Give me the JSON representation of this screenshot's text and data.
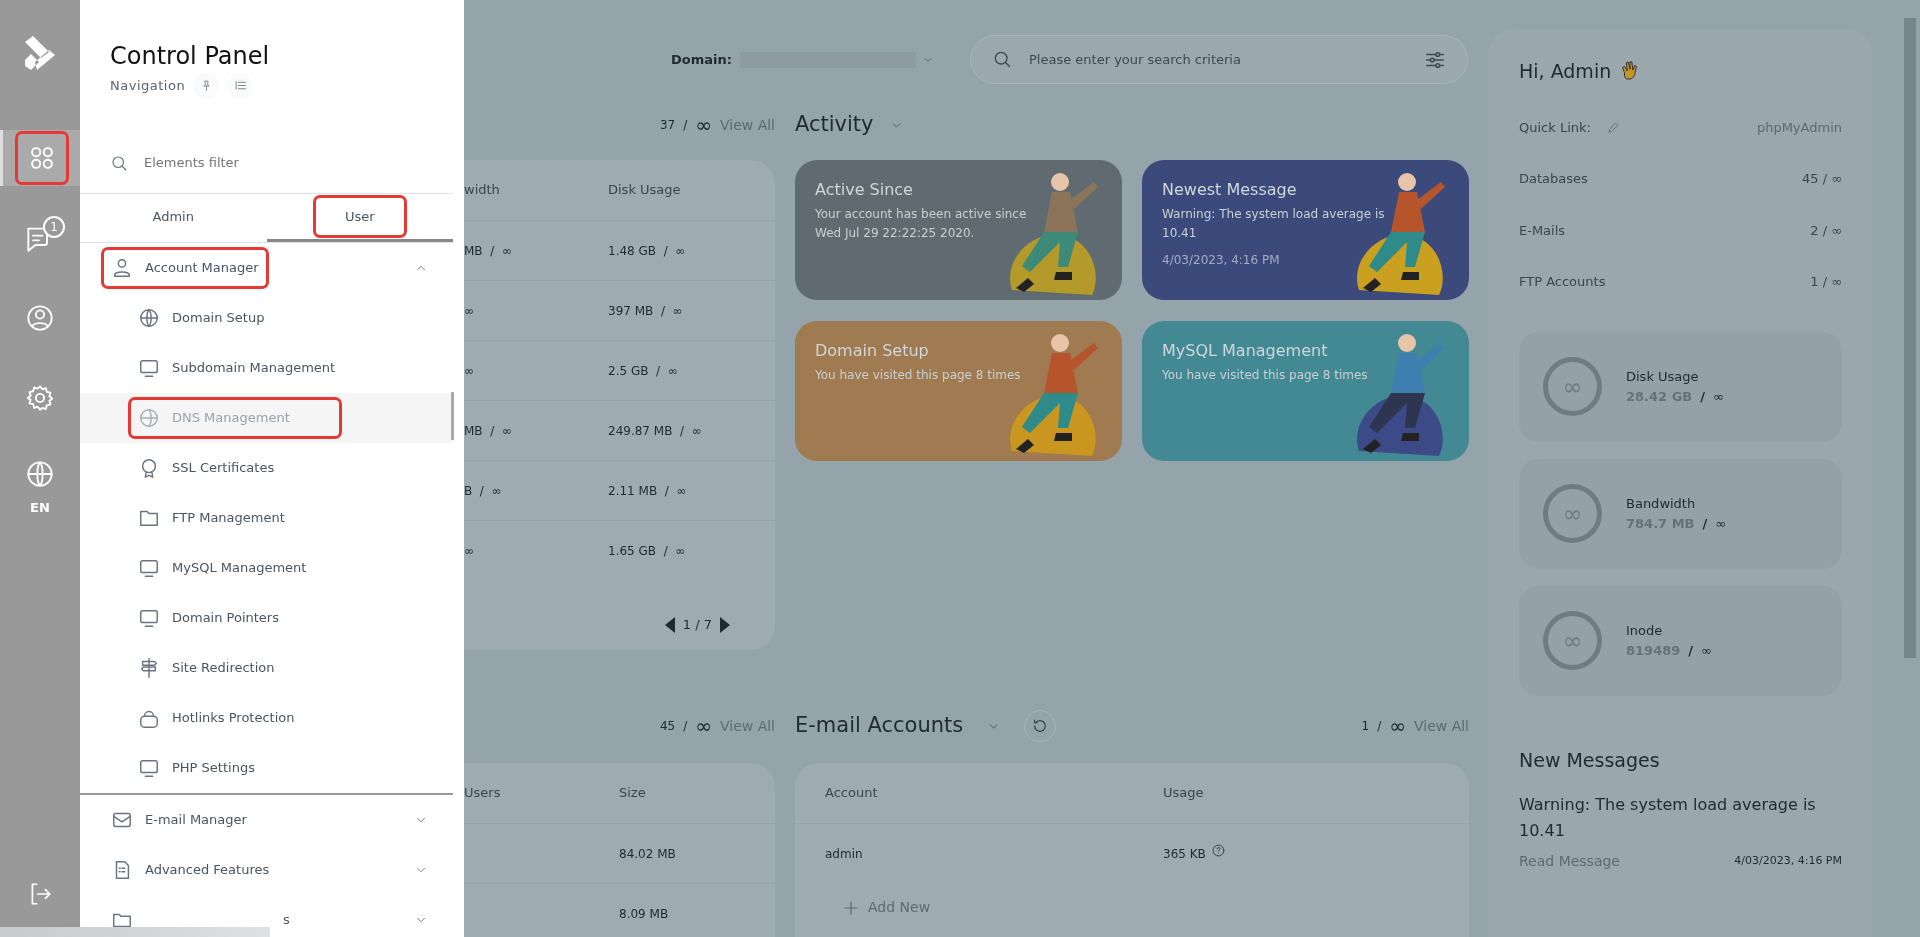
{
  "rail": {
    "items": [
      {
        "kind": "grid",
        "selected": true,
        "highlighted": true
      },
      {
        "kind": "chat",
        "badge": "1",
        "selected": false,
        "highlighted": false
      },
      {
        "kind": "user",
        "selected": false,
        "highlighted": false
      },
      {
        "kind": "gear",
        "selected": false,
        "highlighted": false
      },
      {
        "kind": "globe",
        "label": "EN",
        "selected": false,
        "highlighted": false
      }
    ]
  },
  "nav": {
    "title": "Control Panel",
    "subtitle": "Navigation",
    "filter_placeholder": "Elements filter",
    "tabs": [
      {
        "label": "Admin",
        "selected": false,
        "highlighted": false
      },
      {
        "label": "User",
        "selected": true,
        "highlighted": true
      }
    ],
    "groups": [
      {
        "label": "Account Manager",
        "expanded": true,
        "highlighted": true,
        "children": [
          {
            "label": "Domain Setup",
            "selected": false,
            "highlighted": false
          },
          {
            "label": "Subdomain Management",
            "selected": false,
            "highlighted": false
          },
          {
            "label": "DNS Management",
            "selected": true,
            "highlighted": true
          },
          {
            "label": "SSL Certificates",
            "selected": false,
            "highlighted": false
          },
          {
            "label": "FTP Management",
            "selected": false,
            "highlighted": false
          },
          {
            "label": "MySQL Management",
            "selected": false,
            "highlighted": false
          },
          {
            "label": "Domain Pointers",
            "selected": false,
            "highlighted": false
          },
          {
            "label": "Site Redirection",
            "selected": false,
            "highlighted": false
          },
          {
            "label": "Hotlinks Protection",
            "selected": false,
            "highlighted": false
          },
          {
            "label": "PHP Settings",
            "selected": false,
            "highlighted": false
          }
        ]
      },
      {
        "label": "E-mail Manager",
        "expanded": false,
        "highlighted": false
      },
      {
        "label": "Advanced Features",
        "expanded": false,
        "highlighted": false
      },
      {
        "label": "s",
        "expanded": false,
        "highlighted": false
      }
    ]
  },
  "top": {
    "domain_label": "Domain:",
    "search_placeholder": "Please enter your search criteria"
  },
  "usage_table": {
    "count": "37",
    "separator": "/",
    "limit": "∞",
    "view_all": "View All",
    "columns": [
      "width",
      "Disk Usage"
    ],
    "rows": [
      [
        "MB / ∞",
        "1.48 GB / ∞"
      ],
      [
        "∞",
        "397 MB / ∞"
      ],
      [
        "∞",
        "2.5 GB / ∞"
      ],
      [
        "MB / ∞",
        "249.87 MB / ∞"
      ],
      [
        "B / ∞",
        "2.11 MB / ∞"
      ],
      [
        "∞",
        "1.65 GB / ∞"
      ]
    ],
    "page": "1 / 7"
  },
  "activity": {
    "title": "Activity",
    "cards": [
      {
        "title": "Active Since",
        "text": "Your account has been active since Wed Jul 29 22:22:25 2020.",
        "color": "#5f6b70"
      },
      {
        "title": "Newest Message",
        "text": "Warning: The system load average is 10.41",
        "date": "4/03/2023, 4:16 PM",
        "color": "#3b4a7a"
      },
      {
        "title": "Domain Setup",
        "text": "You have visited this page 8 times",
        "color": "#a07a50"
      },
      {
        "title": "MySQL Management",
        "text": "You have visited this page 8 times",
        "color": "#438994"
      }
    ]
  },
  "db_table": {
    "count": "45",
    "separator": "/",
    "limit": "∞",
    "view_all": "View All",
    "columns": [
      "Users",
      "Size"
    ],
    "rows": [
      {
        "size": "84.02 MB"
      },
      {
        "size": "8.09 MB"
      }
    ]
  },
  "email": {
    "title": "E-mail Accounts",
    "count": "1",
    "separator": "/",
    "limit": "∞",
    "view_all": "View All",
    "columns": [
      "Account",
      "Usage"
    ],
    "rows": [
      {
        "account": "admin",
        "usage": "365 KB"
      }
    ],
    "add_new": "Add New"
  },
  "summary": {
    "greeting": "Hi, Admin",
    "quick_link_label": "Quick Link:",
    "quick_link": "phpMyAdmin",
    "stats": [
      {
        "label": "Databases",
        "value": "45 / ∞"
      },
      {
        "label": "E-Mails",
        "value": "2 / ∞"
      },
      {
        "label": "FTP Accounts",
        "value": "1 / ∞"
      }
    ],
    "usage": [
      {
        "label": "Disk Usage",
        "value": "28.42 GB",
        "separator": "/",
        "limit": "∞",
        "ring": "∞"
      },
      {
        "label": "Bandwidth",
        "value": "784.7 MB",
        "separator": "/",
        "limit": "∞",
        "ring": "∞"
      },
      {
        "label": "Inode",
        "value": "819489",
        "separator": "/",
        "limit": "∞",
        "ring": "∞"
      }
    ],
    "messages_title": "New Messages",
    "messages": [
      {
        "text": "Warning: The system load average is 10.41",
        "link": "Read Message",
        "date": "4/03/2023, 4:16 PM"
      }
    ]
  }
}
